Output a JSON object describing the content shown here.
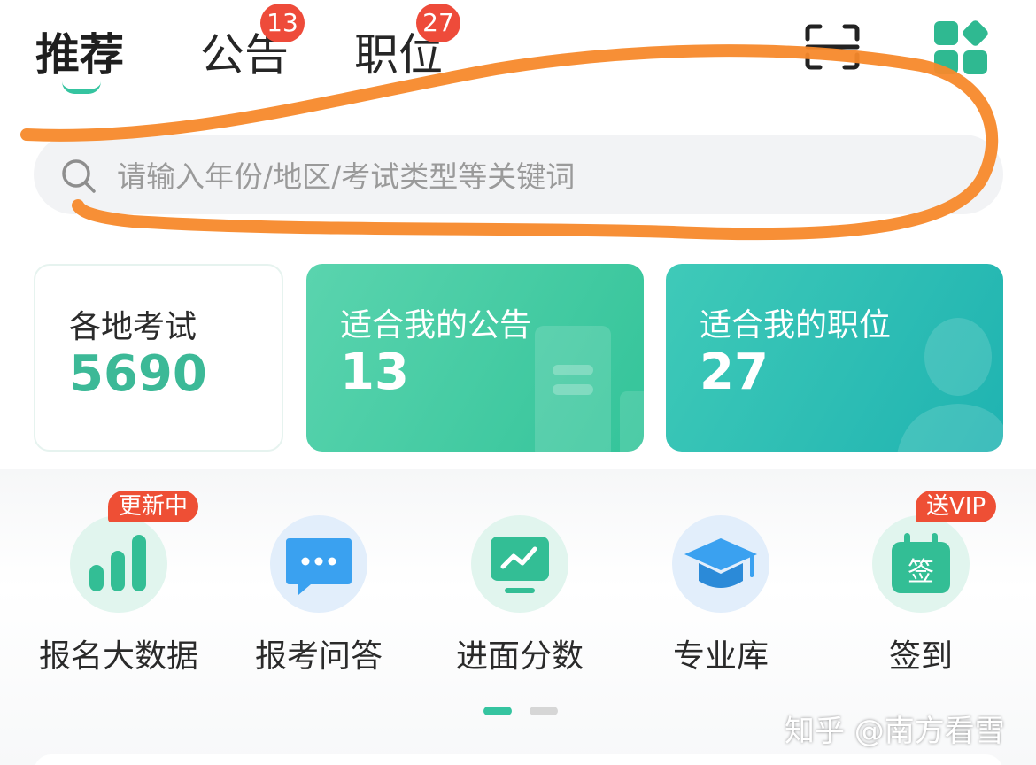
{
  "tabs": [
    {
      "label": "推荐",
      "active": true
    },
    {
      "label": "公告",
      "badge": "13"
    },
    {
      "label": "职位",
      "badge": "27"
    }
  ],
  "header_icons": {
    "scan": "scan-icon",
    "apps": "apps-grid-icon"
  },
  "search": {
    "placeholder": "请输入年份/地区/考试类型等关键词",
    "icon": "search-icon"
  },
  "cards": [
    {
      "title": "各地考试",
      "value": "5690"
    },
    {
      "title": "适合我的公告",
      "value": "13"
    },
    {
      "title": "适合我的职位",
      "value": "27"
    }
  ],
  "tools": [
    {
      "label": "报名大数据",
      "icon": "bar-chart-icon",
      "tag": "更新中"
    },
    {
      "label": "报考问答",
      "icon": "chat-bubble-icon"
    },
    {
      "label": "进面分数",
      "icon": "trend-monitor-icon"
    },
    {
      "label": "专业库",
      "icon": "graduation-cap-icon"
    },
    {
      "label": "签到",
      "icon": "calendar-sign-icon",
      "tag": "送VIP",
      "icon_text": "签"
    }
  ],
  "pager": {
    "total": 2,
    "current": 1
  },
  "watermark": "知乎 @南方看雪",
  "colors": {
    "accent": "#35c4a0",
    "badge": "#ee4b3a",
    "card_green": "#34c49a",
    "card_teal": "#1fb3b1",
    "annotation": "#f7892b"
  }
}
